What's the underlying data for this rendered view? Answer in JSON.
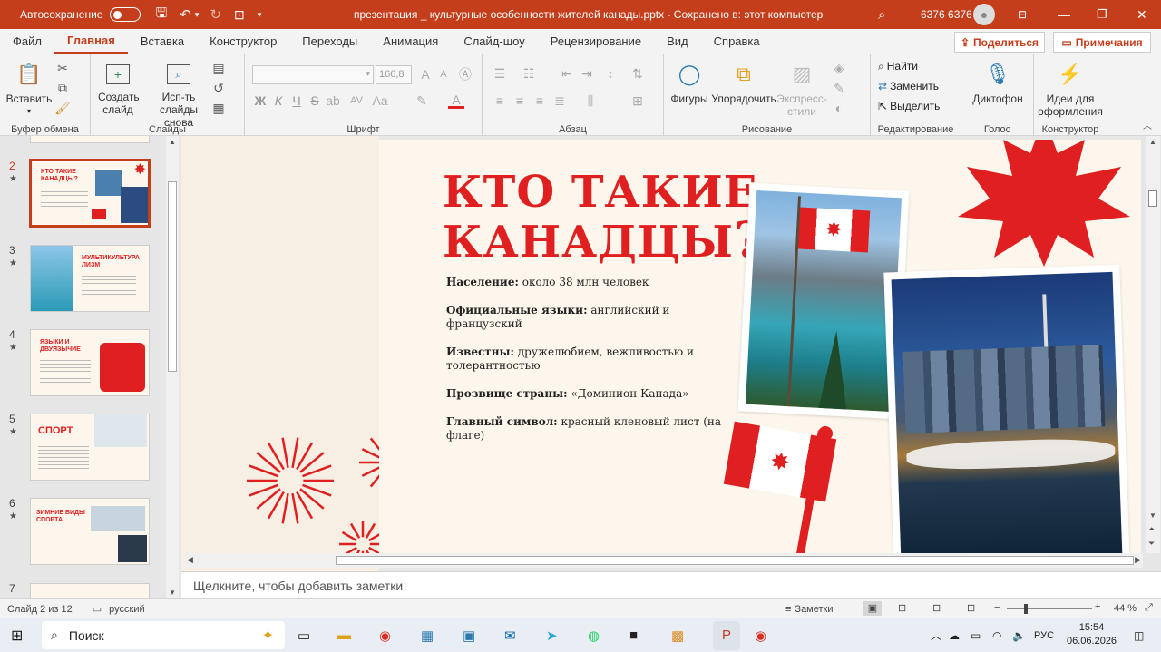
{
  "titlebar": {
    "autosave_label": "Автосохранение",
    "autosave_state": "Откл.",
    "doc_title": "презентация _ культурные особенности жителей канады.pptx  -  Сохранено в: этот компьютер",
    "user_name": "6376 6376"
  },
  "tabs": [
    "Файл",
    "Главная",
    "Вставка",
    "Конструктор",
    "Переходы",
    "Анимация",
    "Слайд-шоу",
    "Рецензирование",
    "Вид",
    "Справка"
  ],
  "share_label": "Поделиться",
  "comments_label": "Примечания",
  "ribbon": {
    "paste": "Вставить",
    "clipboard_group": "Буфер обмена",
    "new_slide": "Создать слайд",
    "reuse": "Исп-ть слайды снова",
    "slides_group": "Слайды",
    "font_size": "166,8",
    "font_group": "Шрифт",
    "bold": "Ж",
    "italic": "К",
    "underline": "Ч",
    "strike": "S",
    "para_group": "Абзац",
    "shapes": "Фигуры",
    "arrange": "Упорядочить",
    "quick_styles": "Экспресс-стили",
    "drawing_group": "Рисование",
    "find": "Найти",
    "replace": "Заменить",
    "select": "Выделить",
    "editing_group": "Редактирование",
    "dictate": "Диктофон",
    "voice_group": "Голос",
    "designer": "Идеи для оформления",
    "designer_group": "Конструктор"
  },
  "thumbnails": [
    {
      "num": "2",
      "title": "КТО ТАКИЕ КАНАДЦЫ?"
    },
    {
      "num": "3",
      "title": "МУЛЬТИКУЛЬТУРАЛИЗМ"
    },
    {
      "num": "4",
      "title": "ЯЗЫКИ И ДВУЯЗЫЧИЕ"
    },
    {
      "num": "5",
      "title": "СПОРТ"
    },
    {
      "num": "6",
      "title": "ЗИМНИЕ ВИДЫ СПОРТА"
    },
    {
      "num": "7",
      "title": ""
    }
  ],
  "slide": {
    "title_line1": "КТО ТАКИЕ",
    "title_line2": "КАНАДЦЫ",
    "title_q": "?",
    "facts": [
      {
        "label": "Население:",
        "value": " около 38 млн человек"
      },
      {
        "label": "Официальные языки:",
        "value": " английский и французский"
      },
      {
        "label": "Известны:",
        "value": " дружелюбием, вежливостью и толерантностью"
      },
      {
        "label": "Прозвище страны:",
        "value": " «Доминион Канада»"
      },
      {
        "label": "Главный символ:",
        "value": " красный кленовый лист (на флаге)"
      }
    ]
  },
  "notes_placeholder": "Щелкните, чтобы добавить заметки",
  "status": {
    "slide_of": "Слайд 2 из 12",
    "language": "русский",
    "notes": "Заметки",
    "zoom": "44 %",
    "zoom_fraction": 0.44
  },
  "taskbar": {
    "search_label": "Поиск",
    "lang": "РУС",
    "time": "15:54",
    "date": "06.06.2026"
  },
  "colors": {
    "accent": "#c43e1c",
    "slide_red": "#e02020",
    "slide_bg": "#fdf6ec"
  }
}
